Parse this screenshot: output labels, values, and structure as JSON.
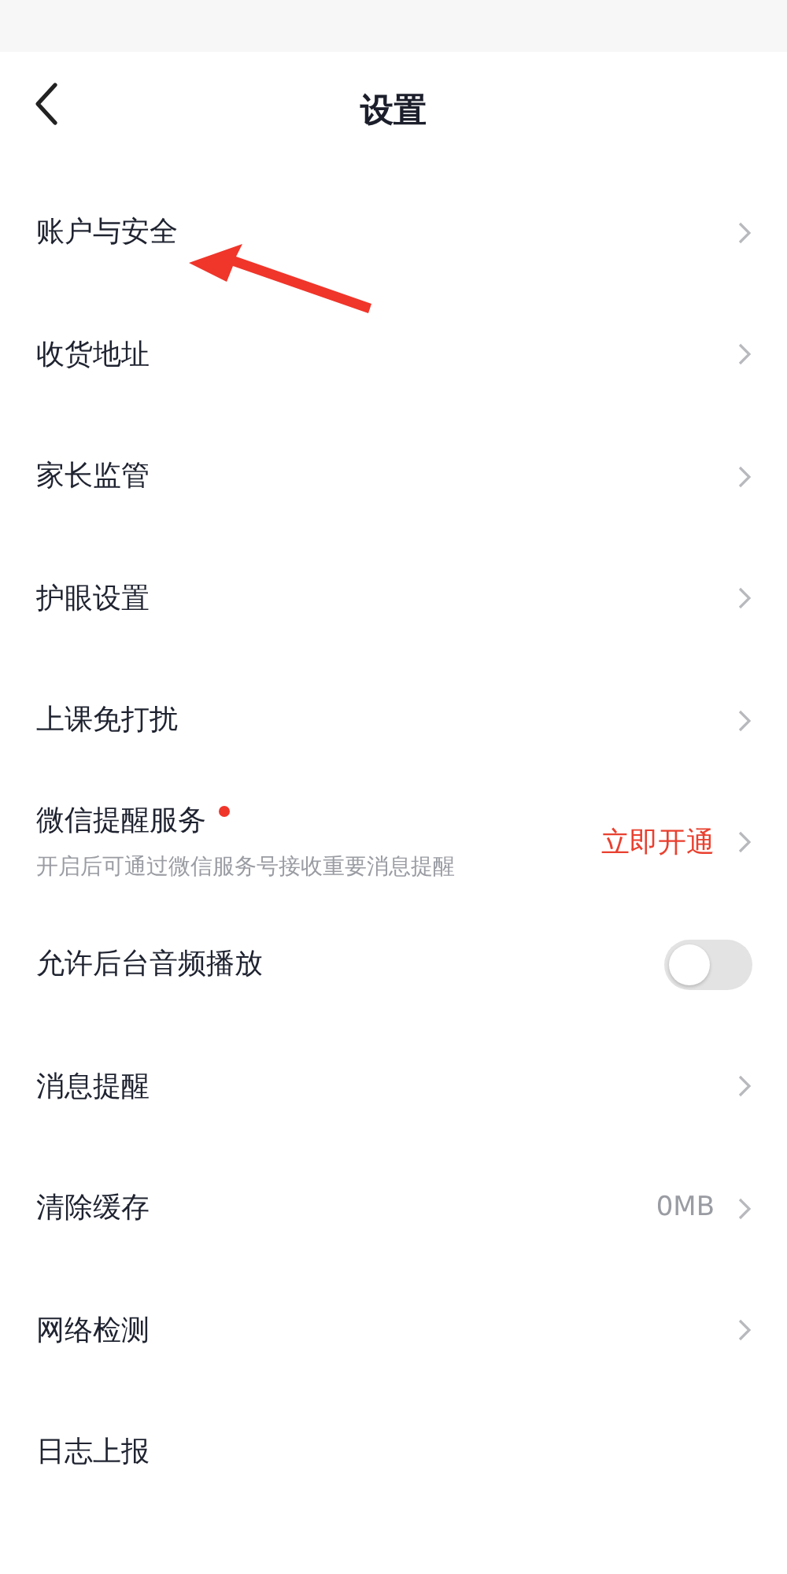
{
  "header": {
    "title": "设置"
  },
  "items": [
    {
      "kind": "link",
      "label": "账户与安全"
    },
    {
      "kind": "link",
      "label": "收货地址"
    },
    {
      "kind": "link",
      "label": "家长监管"
    },
    {
      "kind": "link",
      "label": "护眼设置"
    },
    {
      "kind": "link",
      "label": "上课免打扰"
    },
    {
      "kind": "service",
      "label": "微信提醒服务",
      "badge_dot": true,
      "subtitle": "开启后可通过微信服务号接收重要消息提醒",
      "action": "立即开通"
    },
    {
      "kind": "toggle",
      "label": "允许后台音频播放",
      "on": false
    },
    {
      "kind": "link",
      "label": "消息提醒"
    },
    {
      "kind": "link",
      "label": "清除缓存",
      "value": "0MB"
    },
    {
      "kind": "link",
      "label": "网络检测"
    },
    {
      "kind": "plain",
      "label": "日志上报"
    }
  ]
}
